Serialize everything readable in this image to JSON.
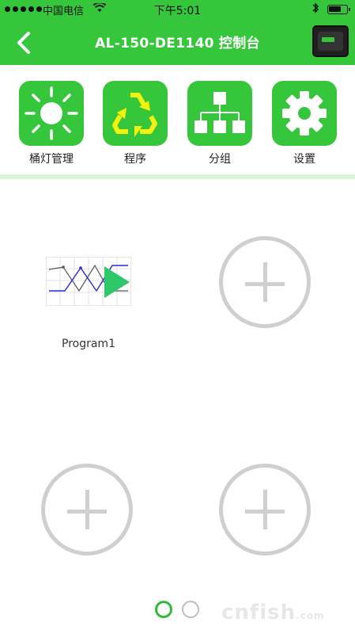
{
  "status_bar": {
    "carrier": "中国电信",
    "time": "下午5:01",
    "battery_level": 0.75
  },
  "nav": {
    "title": "AL-150-DE1140 控制台"
  },
  "menu": {
    "items": [
      {
        "label": "桶灯管理",
        "icon": "sun-icon"
      },
      {
        "label": "程序",
        "icon": "recycle-icon"
      },
      {
        "label": "分组",
        "icon": "hierarchy-icon"
      },
      {
        "label": "设置",
        "icon": "gear-icon"
      }
    ]
  },
  "programs": [
    {
      "label": "Program1"
    }
  ],
  "pager": {
    "pages": 2,
    "active": 1
  },
  "watermark": {
    "text": "cnfish",
    "suffix": ".com"
  },
  "colors": {
    "primary": "#35c63b",
    "divider": "#d8f3d8",
    "add_circle": "#cfcfcf"
  }
}
